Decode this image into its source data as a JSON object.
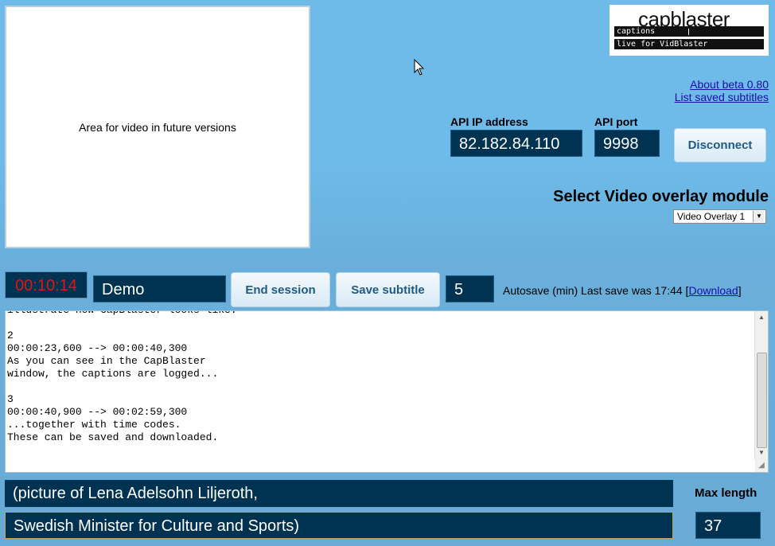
{
  "video": {
    "placeholder_text": "Area for video in future versions"
  },
  "logo": {
    "brand": "capblaster",
    "line1": "captions",
    "line2": "live for VidBlaster"
  },
  "links": {
    "about": "About beta 0.80",
    "list_saved": "List saved subtitles"
  },
  "api": {
    "ip_label": "API IP address",
    "ip_value": "82.182.84.110",
    "port_label": "API port",
    "port_value": "9998",
    "disconnect_label": "Disconnect"
  },
  "overlay": {
    "heading": "Select Video overlay module",
    "selected": "Video Overlay 1"
  },
  "session": {
    "timer": "00:10:14",
    "name": "Demo",
    "end_label": "End session",
    "save_label": "Save subtitle",
    "autosave_value": "5",
    "autosave_text": "Autosave (min) Last save was 17:44 [",
    "download_label": "Download",
    "autosave_close": "]"
  },
  "editor": {
    "lines": [
      "illustrate how CapBlaster looks like.",
      "",
      "2",
      "00:00:23,600 --> 00:00:40,300",
      "As you can see in the CapBlaster",
      "window, the captions are logged...",
      "",
      "3",
      "00:00:40,900 --> 00:02:59,300",
      "...together with time codes.",
      "These can be saved and downloaded."
    ]
  },
  "caption": {
    "line1": "(picture of Lena Adelsohn Liljeroth,",
    "line2": "Swedish Minister for Culture and Sports)",
    "max_length_label": "Max length",
    "max_length_value": "37"
  },
  "icons": {
    "cursor": "mouse-pointer-icon"
  }
}
